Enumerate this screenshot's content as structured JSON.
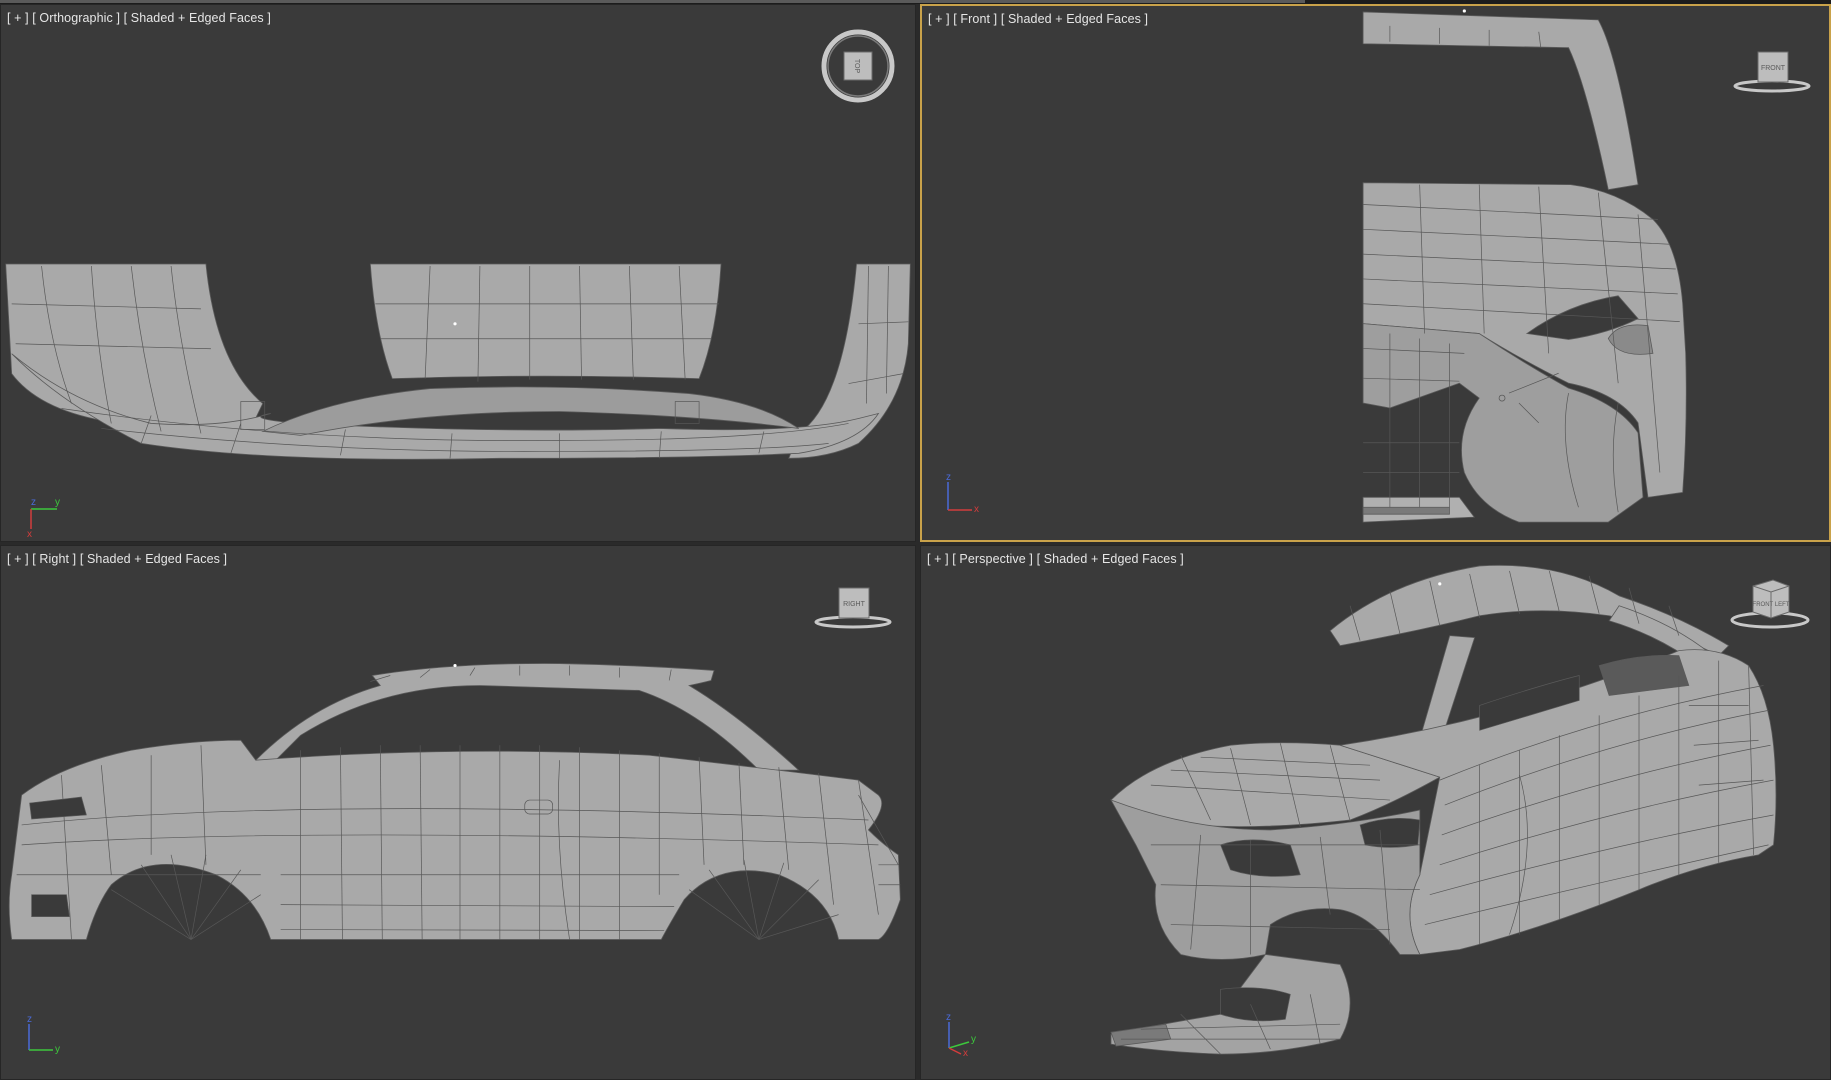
{
  "app": {
    "viewports": [
      {
        "id": "top",
        "plus": "[ + ]",
        "view": "[ Orthographic ]",
        "shading": "[ Shaded + Edged Faces ]",
        "navcube_label": "TOP",
        "gizmo_axes": [
          "z",
          "y",
          "x"
        ],
        "active": false
      },
      {
        "id": "front",
        "plus": "[ + ]",
        "view": "[ Front ]",
        "shading": "[ Shaded + Edged Faces ]",
        "navcube_label": "FRONT",
        "gizmo_axes": [
          "z",
          "x"
        ],
        "active": true
      },
      {
        "id": "right",
        "plus": "[ + ]",
        "view": "[ Right ]",
        "shading": "[ Shaded + Edged Faces ]",
        "navcube_label": "RIGHT",
        "gizmo_axes": [
          "z",
          "y"
        ],
        "active": false
      },
      {
        "id": "perspective",
        "plus": "[ + ]",
        "view": "[ Perspective ]",
        "shading": "[ Shaded + Edged Faces ]",
        "navcube_label": "FRONT LEFT",
        "gizmo_axes": [
          "z",
          "y",
          "x"
        ],
        "active": false
      }
    ],
    "colors": {
      "viewport_bg": "#3a3a3a",
      "frame_bg": "#2a2a2a",
      "active_border": "#c9a24a",
      "mesh_fill": "#a9a9a9",
      "mesh_edge": "#5c5c5c",
      "axis_x": "#d23c3c",
      "axis_y": "#3cc83c",
      "axis_z": "#4a6ad8"
    }
  }
}
